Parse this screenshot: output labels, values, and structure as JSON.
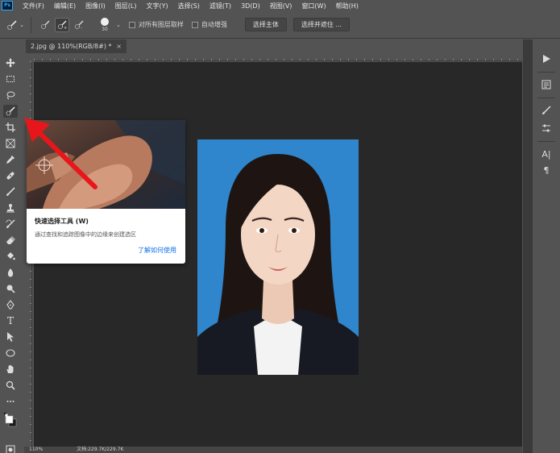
{
  "app": {
    "logo": "Ps"
  },
  "menu": [
    "文件(F)",
    "编辑(E)",
    "图像(I)",
    "图层(L)",
    "文字(Y)",
    "选择(S)",
    "滤镜(T)",
    "3D(D)",
    "视图(V)",
    "窗口(W)",
    "帮助(H)"
  ],
  "options": {
    "brush_size": "30",
    "sample_all_layers": "对所有图层取样",
    "auto_enhance": "自动增强",
    "select_subject": "选择主体",
    "select_and_mask": "选择并遮住 ..."
  },
  "document": {
    "tab_title": "2.jpg @ 110%(RGB/8#) *",
    "close_glyph": "×"
  },
  "tooltip": {
    "title": "快速选择工具 (W)",
    "description": "通过查找和追踪图像中的边缘来创建选区",
    "link": "了解如何使用"
  },
  "toolbar": {
    "type_tool_glyph": "T"
  },
  "right_dock": {
    "character_glyph": "A|",
    "paragraph_glyph": "¶"
  },
  "status": {
    "zoom": "110%",
    "doc_size": "文档:229.7K/229.7K"
  },
  "colors": {
    "ui_bg": "#535353",
    "canvas_bg": "#282828",
    "photo_bg": "#2f86cc",
    "link": "#1473e6",
    "arrow": "#e8161b"
  }
}
